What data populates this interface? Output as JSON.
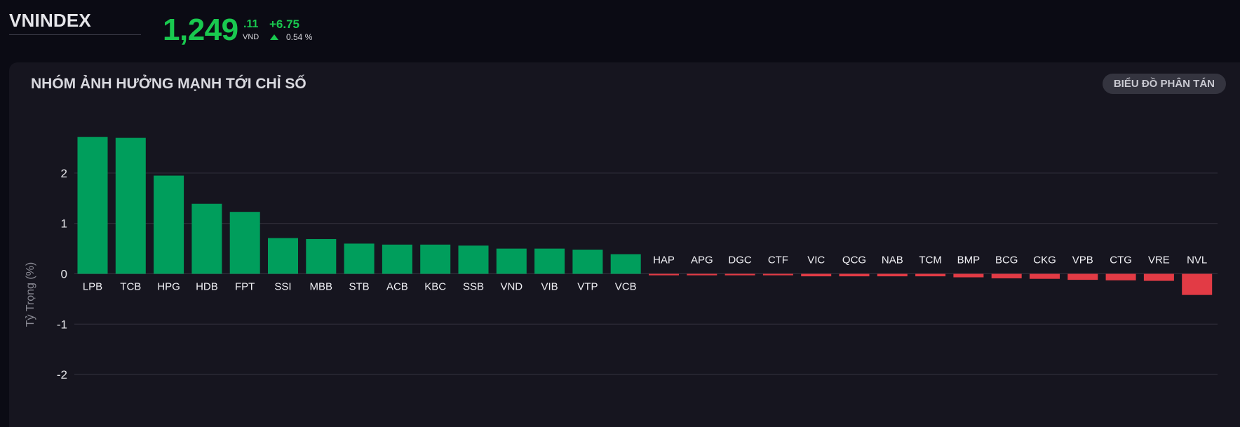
{
  "index": {
    "name": "VNINDEX",
    "price_int": "1,249",
    "price_dec": ".11",
    "unit": "VND",
    "change_abs": "+6.75",
    "change_pct": "0.54 %",
    "direction": "up",
    "up_color": "#19c94f"
  },
  "panel": {
    "title": "NHÓM ẢNH HƯỞNG MẠNH TỚI CHỈ SỐ",
    "scatter_button": "BIỂU ĐỒ PHÂN TÁN"
  },
  "chart_data": {
    "type": "bar",
    "ylabel": "Tỷ Trọng (%)",
    "xlabel": "",
    "ylim": [
      -2.6,
      2.95
    ],
    "yticks": [
      2,
      1,
      0,
      -1,
      -2
    ],
    "grid": true,
    "positive_color": "#009e5c",
    "negative_color": "#e23b45",
    "categories": [
      "LPB",
      "TCB",
      "HPG",
      "HDB",
      "FPT",
      "SSI",
      "MBB",
      "STB",
      "ACB",
      "KBC",
      "SSB",
      "VND",
      "VIB",
      "VTP",
      "VCB",
      "HAP",
      "APG",
      "DGC",
      "CTF",
      "VIC",
      "QCG",
      "NAB",
      "TCM",
      "BMP",
      "BCG",
      "CKG",
      "VPB",
      "CTG",
      "VRE",
      "NVL"
    ],
    "values": [
      2.72,
      2.7,
      1.95,
      1.39,
      1.23,
      0.71,
      0.69,
      0.6,
      0.58,
      0.58,
      0.56,
      0.5,
      0.5,
      0.48,
      0.39,
      -0.03,
      -0.03,
      -0.03,
      -0.03,
      -0.05,
      -0.05,
      -0.05,
      -0.05,
      -0.07,
      -0.09,
      -0.1,
      -0.12,
      -0.13,
      -0.14,
      -0.42
    ]
  }
}
